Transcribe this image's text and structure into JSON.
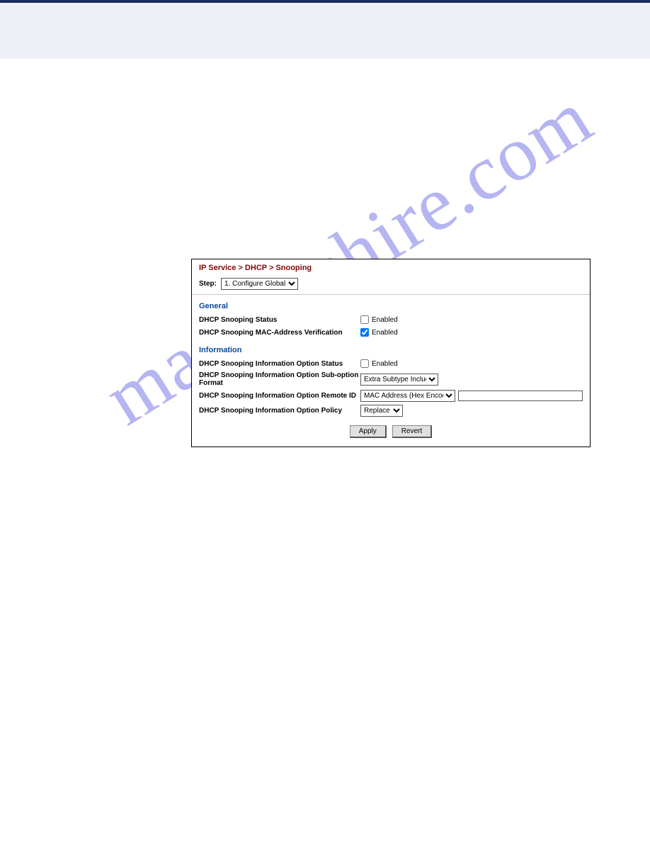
{
  "watermark": "manualshire.com",
  "panel": {
    "breadcrumb": "IP Service > DHCP > Snooping",
    "step_label": "Step:",
    "step_value": "1. Configure Global",
    "section_general": "General",
    "section_information": "Information",
    "rows": {
      "snooping_status": {
        "label": "DHCP Snooping Status",
        "check_label": "Enabled",
        "checked": false
      },
      "mac_verify": {
        "label": "DHCP Snooping MAC-Address Verification",
        "check_label": "Enabled",
        "checked": true
      },
      "info_status": {
        "label": "DHCP Snooping Information Option Status",
        "check_label": "Enabled",
        "checked": false
      },
      "subopt_format": {
        "label": "DHCP Snooping Information Option Sub-option Format",
        "value": "Extra Subtype Included"
      },
      "remote_id": {
        "label": "DHCP Snooping Information Option Remote ID",
        "value": "MAC Address (Hex Encoded)",
        "text": ""
      },
      "policy": {
        "label": "DHCP Snooping Information Option Policy",
        "value": "Replace"
      }
    },
    "buttons": {
      "apply": "Apply",
      "revert": "Revert"
    }
  }
}
